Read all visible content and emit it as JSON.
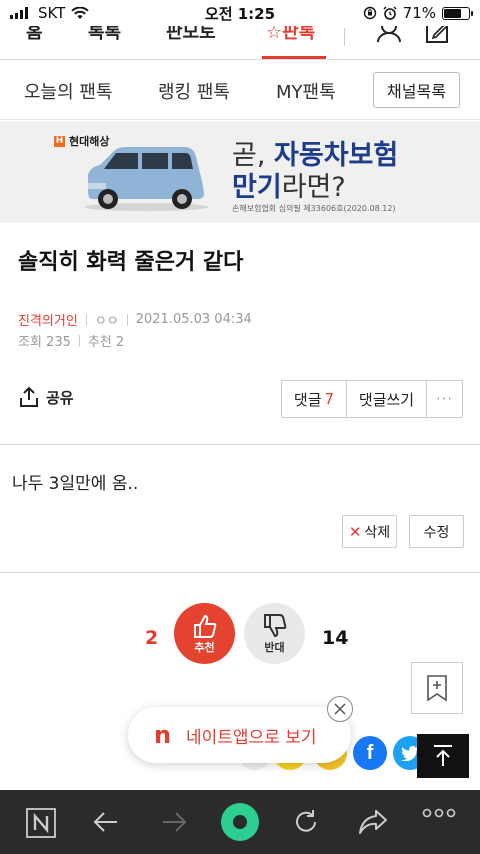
{
  "status_bar": {
    "carrier": "SKT",
    "time": "오전 1:25",
    "battery_percent": "71%",
    "battery_level": 0.71
  },
  "top_nav": {
    "items": [
      "홈",
      "톡톡",
      "판모토",
      "판톡"
    ],
    "active_index": 3
  },
  "sub_tabs": {
    "items": [
      "오늘의 팬톡",
      "랭킹 팬톡",
      "MY팬톡"
    ],
    "channel_button": "채널목록"
  },
  "ad": {
    "brand": "현대해상",
    "line1_prefix": "곧, ",
    "line1_bold": "자동차보험",
    "line2_bold": "만기",
    "line2_suffix": "라면?",
    "fine_print": "손해보험협회 심의필 제33606호(2020.08.12)"
  },
  "post": {
    "title": "솔직히 화력 줄은거 같다",
    "author": "진격의거인",
    "author_suffix": "ㅇㅇ",
    "datetime": "2021.05.03 04:34",
    "views": "조회 235",
    "recommend": "추천 2",
    "body": "나두 3일만에 옴..",
    "delete_label": "삭제",
    "edit_label": "수정"
  },
  "actions": {
    "share_label": "공유",
    "comment_label": "댓글",
    "comment_count": "7",
    "write_comment_label": "댓글쓰기",
    "more_label": "···"
  },
  "votes": {
    "like_count": "2",
    "like_label": "추천",
    "dislike_label": "반대",
    "dislike_count": "14"
  },
  "app_banner": {
    "label": "네이트앱으로 보기",
    "logo": "n"
  },
  "social": {
    "facebook": "f"
  },
  "colors": {
    "accent": "#e63c2f",
    "ad_blue": "#1d3c8c",
    "bottom_bar": "#2b2b2b",
    "facebook": "#1877f2",
    "twitter": "#1da1f2"
  }
}
